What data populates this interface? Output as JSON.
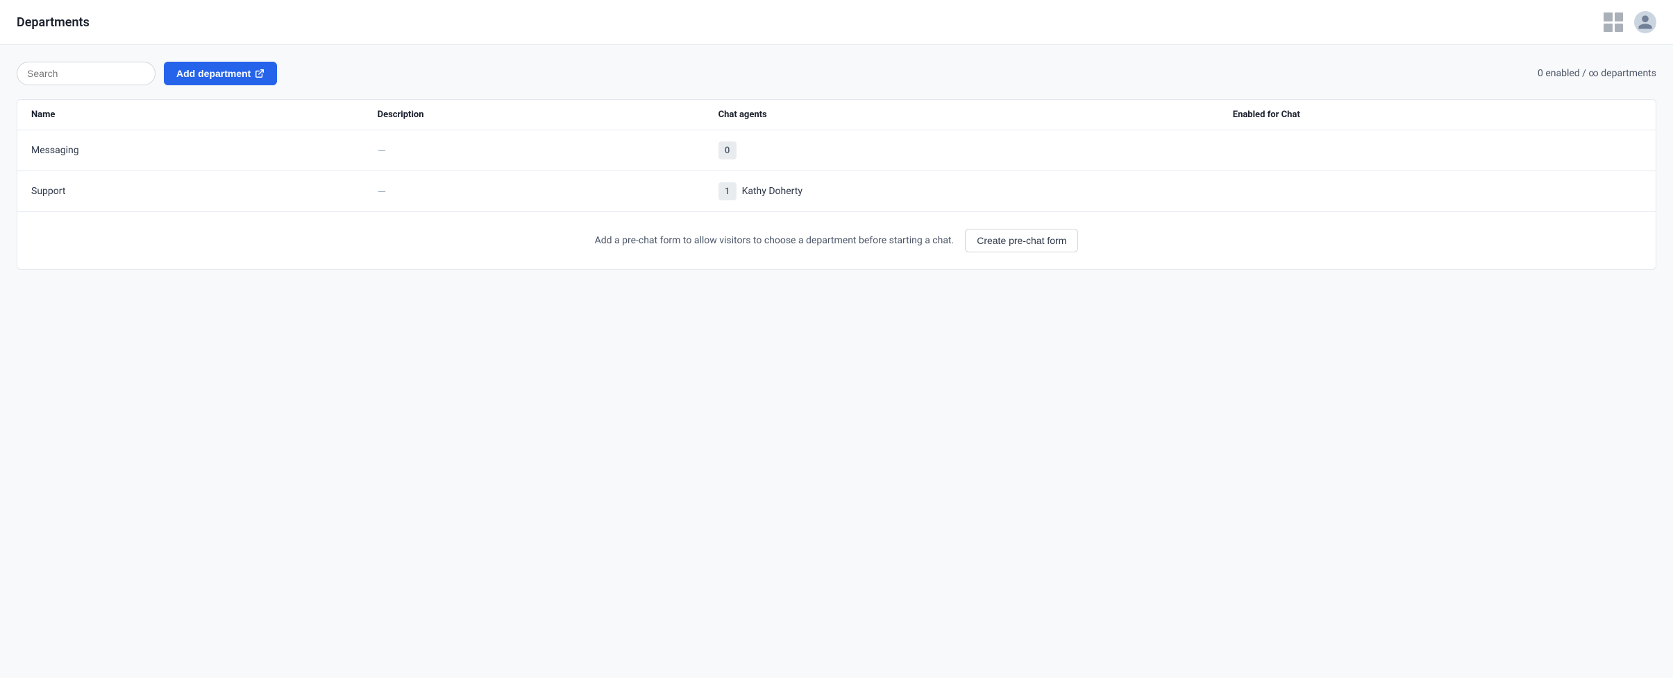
{
  "header": {
    "title": "Departments",
    "grid_icon_label": "grid-icon",
    "avatar_label": "user-avatar"
  },
  "toolbar": {
    "search_placeholder": "Search",
    "add_button_label": "Add department",
    "stats_text": "0 enabled / ∞ departments"
  },
  "table": {
    "columns": [
      {
        "key": "name",
        "label": "Name"
      },
      {
        "key": "description",
        "label": "Description"
      },
      {
        "key": "chat_agents",
        "label": "Chat agents"
      },
      {
        "key": "enabled_for_chat",
        "label": "Enabled for Chat"
      }
    ],
    "rows": [
      {
        "name": "Messaging",
        "description": "—",
        "agent_count": "0",
        "agent_names": "",
        "enabled_for_chat": ""
      },
      {
        "name": "Support",
        "description": "—",
        "agent_count": "1",
        "agent_names": "Kathy Doherty",
        "enabled_for_chat": ""
      }
    ]
  },
  "pre_chat_banner": {
    "text": "Add a pre-chat form to allow visitors to choose a department before starting a chat.",
    "button_label": "Create pre-chat form"
  }
}
